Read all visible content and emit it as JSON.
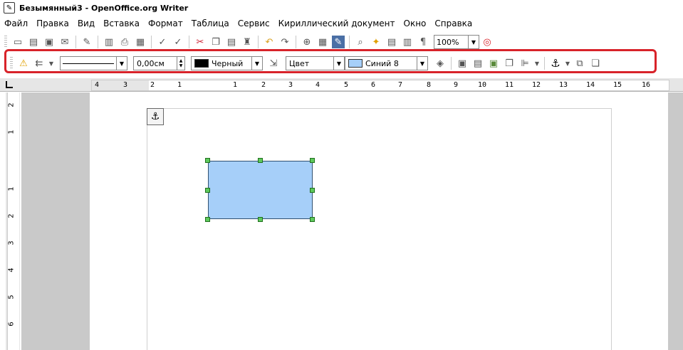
{
  "window": {
    "title": "Безымянный3 - OpenOffice.org Writer"
  },
  "menu": [
    "Файл",
    "Правка",
    "Вид",
    "Вставка",
    "Формат",
    "Таблица",
    "Сервис",
    "Кириллический документ",
    "Окно",
    "Справка"
  ],
  "standard_toolbar": {
    "zoom": "100%"
  },
  "drawing_toolbar": {
    "line_width": "0,00см",
    "line_color": "Черный",
    "area_style": "Цвет",
    "area_color": "Синий 8",
    "line_color_hex": "#000000",
    "area_color_hex": "#a6cff9"
  },
  "ruler_h": [
    "4",
    "3",
    "2",
    "1",
    "1",
    "2",
    "3",
    "4",
    "5",
    "6",
    "7",
    "8",
    "9",
    "10",
    "11",
    "12",
    "13",
    "14",
    "15",
    "16"
  ],
  "ruler_v": [
    "2",
    "1",
    "1",
    "2",
    "3",
    "4",
    "5",
    "6"
  ],
  "highlight_color": "#d8232a",
  "shape": {
    "fill": "#a6cff9",
    "handle_color": "#5ec95c"
  }
}
